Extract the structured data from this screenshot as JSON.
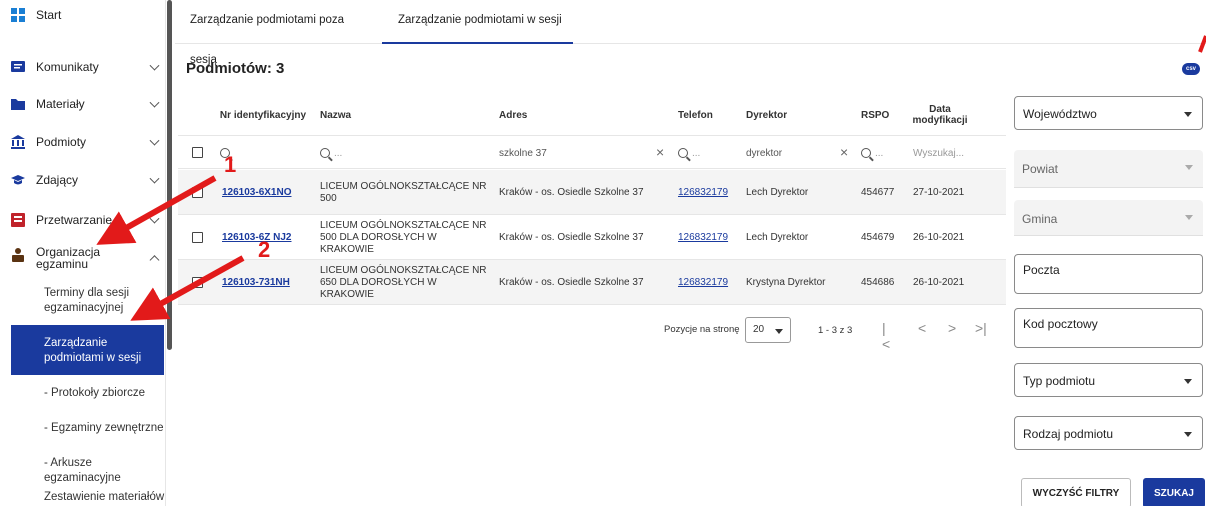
{
  "sidebar": {
    "start": "Start",
    "komunikaty": "Komunikaty",
    "materialy": "Materiały",
    "podmioty": "Podmioty",
    "zdajacy": "Zdający",
    "przetwarzanie": "Przetwarzanie",
    "organizacja": "Organizacja egzaminu",
    "sub": {
      "terminy": "Terminy dla sesji egzaminacyjnej",
      "zarzadzanie": "Zarządzanie podmiotami w sesji",
      "protokoly": "- Protokoły zbiorcze",
      "egzaminy": "- Egzaminy zewnętrzne",
      "arkusze": "- Arkusze egzaminacyjne",
      "zestawienie": "Zestawienie materiałów"
    }
  },
  "tabs": [
    "Zarządzanie podmiotami poza sesją",
    "Zarządzanie podmiotami w sesji"
  ],
  "count_title": "Podmiotów: 3",
  "csv_label": "csv",
  "table": {
    "headers": {
      "id": "Nr identyfikacyjny",
      "name": "Nazwa",
      "address": "Adres",
      "phone": "Telefon",
      "director": "Dyrektor",
      "rspo": "RSPO",
      "date": "Data modyfikacji"
    },
    "filters": {
      "id_ph": "",
      "name_ph": "...",
      "address_val": "szkolne 37",
      "phone_ph": "...",
      "director_val": "dyrektor",
      "rspo_ph": "...",
      "date_ph": "Wyszukaj..."
    },
    "rows": [
      {
        "id": "126103-6X1NO",
        "name": "LICEUM OGÓLNOKSZTAŁCĄCE NR 500",
        "address": "Kraków - os. Osiedle Szkolne 37",
        "phone": "126832179",
        "director": "Lech Dyrektor",
        "rspo": "454677",
        "date": "27-10-2021"
      },
      {
        "id": "126103-6Z NJ2",
        "name": "LICEUM OGÓLNOKSZTAŁCĄCE NR 500 DLA DOROSŁYCH W KRAKOWIE",
        "address": "Kraków - os. Osiedle Szkolne 37",
        "phone": "126832179",
        "director": "Lech Dyrektor",
        "rspo": "454679",
        "date": "26-10-2021"
      },
      {
        "id": "126103-731NH",
        "name": "LICEUM OGÓLNOKSZTAŁCĄCE NR 650 DLA DOROSŁYCH W KRAKOWIE",
        "address": "Kraków - os. Osiedle Szkolne 37",
        "phone": "126832179",
        "director": "Krystyna Dyrektor",
        "rspo": "454686",
        "date": "26-10-2021"
      }
    ]
  },
  "pager": {
    "label": "Pozycje na stronę",
    "size": "20",
    "range": "1 - 3 z 3"
  },
  "filters_right": {
    "wojewodztwo": "Województwo",
    "powiat": "Powiat",
    "gmina": "Gmina",
    "poczta": "Poczta",
    "kod": "Kod pocztowy",
    "typ": "Typ podmiotu",
    "rodzaj": "Rodzaj podmiotu",
    "clear": "WYCZYŚĆ FILTRY",
    "search": "SZUKAJ"
  },
  "annotations": {
    "one": "1",
    "two": "2",
    "color": "#e21a1a"
  },
  "colors": {
    "primary": "#1a3a9e"
  }
}
